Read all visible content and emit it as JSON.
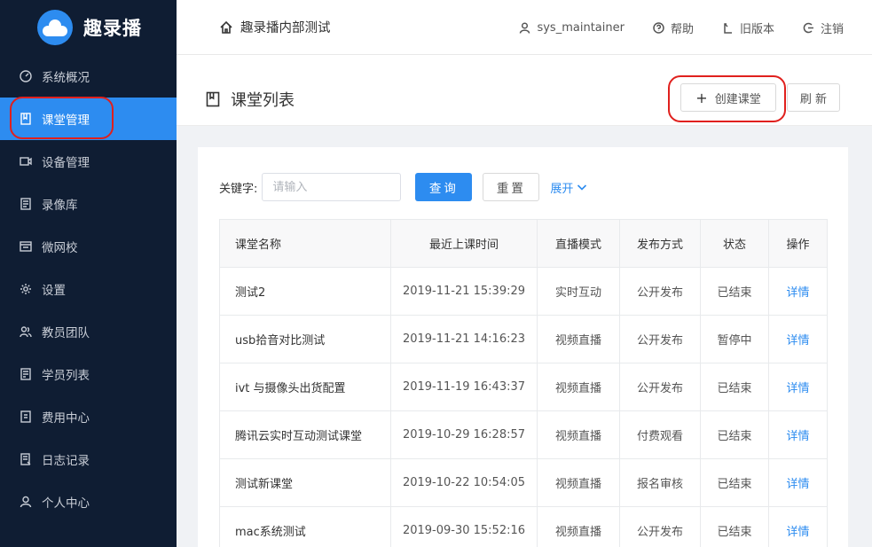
{
  "app": {
    "name": "趣录播"
  },
  "sidebar": {
    "items": [
      {
        "label": "系统概况",
        "icon": "dashboard-icon"
      },
      {
        "label": "课堂管理",
        "icon": "book-icon"
      },
      {
        "label": "设备管理",
        "icon": "camera-icon"
      },
      {
        "label": "录像库",
        "icon": "library-icon"
      },
      {
        "label": "微网校",
        "icon": "school-icon"
      },
      {
        "label": "设置",
        "icon": "gear-icon"
      },
      {
        "label": "教员团队",
        "icon": "team-icon"
      },
      {
        "label": "学员列表",
        "icon": "student-list-icon"
      },
      {
        "label": "费用中心",
        "icon": "billing-icon"
      },
      {
        "label": "日志记录",
        "icon": "log-icon"
      },
      {
        "label": "个人中心",
        "icon": "user-icon"
      }
    ],
    "active_index": 1
  },
  "header": {
    "title": "趣录播内部测试",
    "user": "sys_maintainer",
    "help": "帮助",
    "old_version": "旧版本",
    "logout": "注销"
  },
  "page": {
    "title": "课堂列表",
    "create_button": "创建课堂",
    "refresh_button": "刷 新"
  },
  "search": {
    "label": "关键字:",
    "placeholder": "请输入",
    "query_button": "查询",
    "reset_button": "重置",
    "expand": "展开"
  },
  "table": {
    "columns": [
      "课堂名称",
      "最近上课时间",
      "直播模式",
      "发布方式",
      "状态",
      "操作"
    ],
    "rows": [
      [
        "测试2",
        "2019-11-21 15:39:29",
        "实时互动",
        "公开发布",
        "已结束",
        "详情"
      ],
      [
        "usb拾音对比测试",
        "2019-11-21 14:16:23",
        "视频直播",
        "公开发布",
        "暂停中",
        "详情"
      ],
      [
        "ivt 与摄像头出货配置",
        "2019-11-19 16:43:37",
        "视频直播",
        "公开发布",
        "已结束",
        "详情"
      ],
      [
        "腾讯云实时互动测试课堂",
        "2019-10-29 16:28:57",
        "视频直播",
        "付费观看",
        "已结束",
        "详情"
      ],
      [
        "测试新课堂",
        "2019-10-22 10:54:05",
        "视频直播",
        "报名审核",
        "已结束",
        "详情"
      ],
      [
        "mac系统测试",
        "2019-09-30 15:52:16",
        "视频直播",
        "公开发布",
        "已结束",
        "详情"
      ]
    ]
  },
  "colors": {
    "sidebar_bg": "#0f1d33",
    "accent": "#2d8cf0",
    "annotation_red": "#e0201d"
  }
}
